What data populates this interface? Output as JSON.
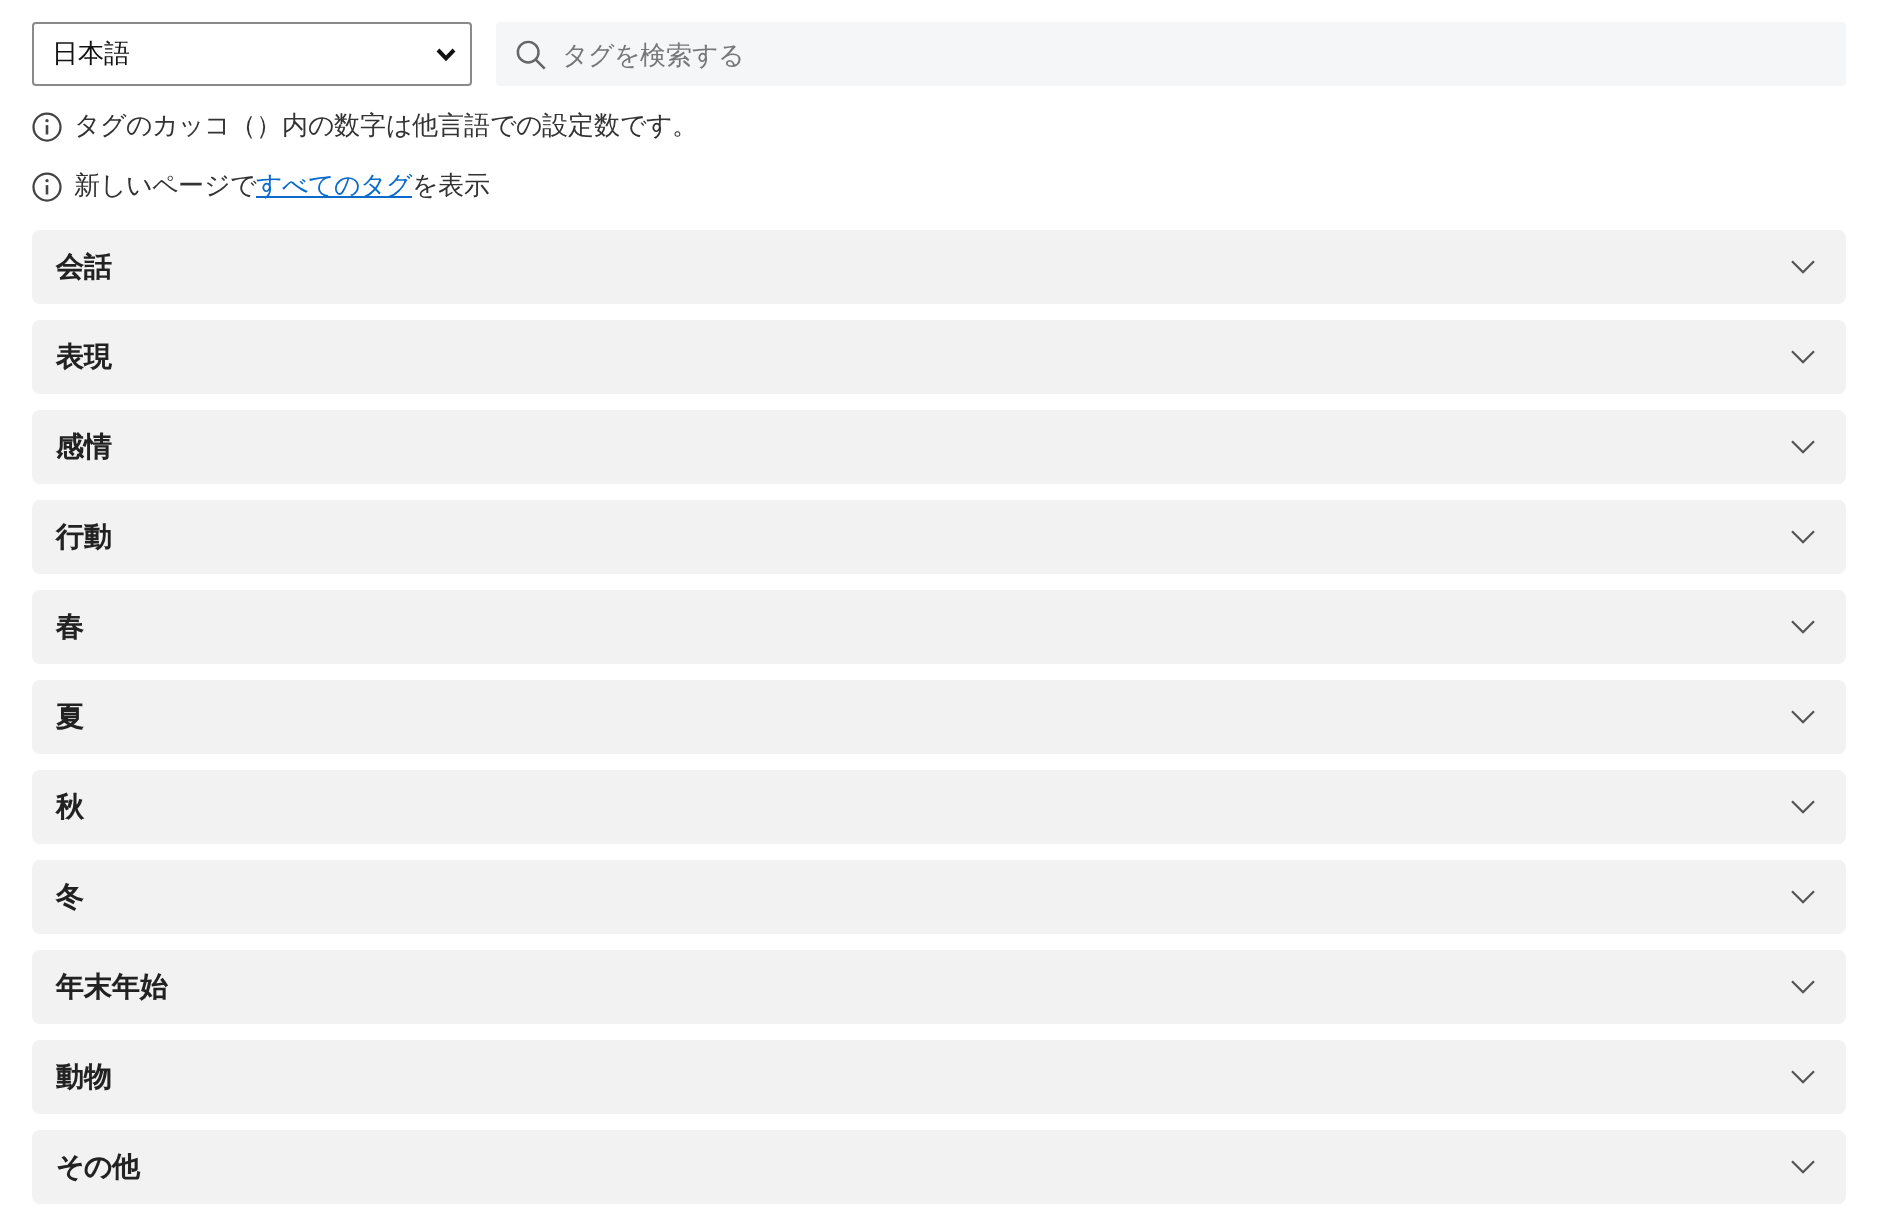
{
  "language_select": {
    "value": "日本語"
  },
  "search": {
    "placeholder": "タグを検索する"
  },
  "notes": [
    {
      "kind": "plain",
      "text": "タグのカッコ（）内の数字は他言語での設定数です。"
    },
    {
      "kind": "link",
      "before": "新しいページで",
      "link": "すべてのタグ",
      "after": "を表示"
    }
  ],
  "categories": [
    {
      "label": "会話",
      "expanded": false
    },
    {
      "label": "表現",
      "expanded": false
    },
    {
      "label": "感情",
      "expanded": false
    },
    {
      "label": "行動",
      "expanded": false
    },
    {
      "label": "春",
      "expanded": false
    },
    {
      "label": "夏",
      "expanded": false
    },
    {
      "label": "秋",
      "expanded": false
    },
    {
      "label": "冬",
      "expanded": false
    },
    {
      "label": "年末年始",
      "expanded": false
    },
    {
      "label": "動物",
      "expanded": false
    },
    {
      "label": "その他",
      "expanded": false
    }
  ]
}
